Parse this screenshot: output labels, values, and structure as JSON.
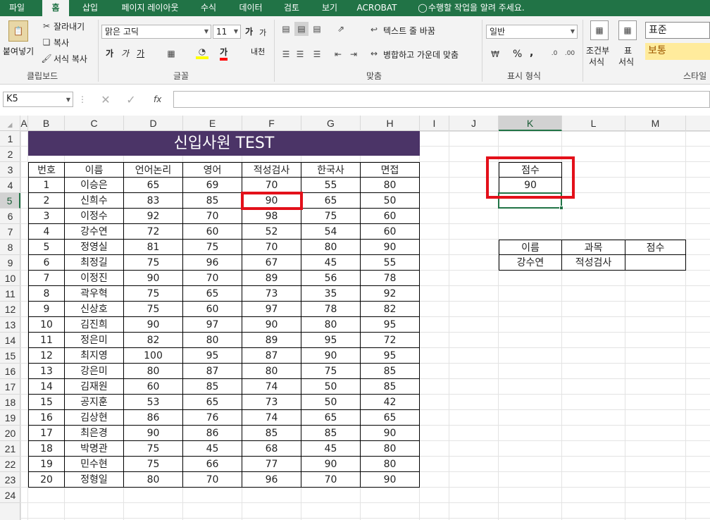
{
  "tabs": [
    {
      "label": "파일",
      "active": false
    },
    {
      "label": "홈",
      "active": true
    },
    {
      "label": "삽입",
      "active": false
    },
    {
      "label": "페이지 레이아웃",
      "active": false
    },
    {
      "label": "수식",
      "active": false
    },
    {
      "label": "데이터",
      "active": false
    },
    {
      "label": "검토",
      "active": false
    },
    {
      "label": "보기",
      "active": false
    },
    {
      "label": "ACROBAT",
      "active": false
    }
  ],
  "tell_me": "수행할 작업을 알려 주세요.",
  "ribbon": {
    "clipboard": {
      "group": "클립보드",
      "paste": "붙여넣기",
      "cut": "잘라내기",
      "copy": "복사",
      "format_painter": "서식 복사"
    },
    "font": {
      "group": "글꼴",
      "name": "맑은 고딕",
      "size": "11",
      "grow": "가",
      "shrink": "가",
      "bold": "가",
      "italic": "가",
      "underline": "가",
      "font_color": "가",
      "phonetic": "내천"
    },
    "alignment": {
      "group": "맞춤",
      "wrap_text": "텍스트 줄 바꿈",
      "merge_center": "병합하고 가운데 맞춤"
    },
    "number": {
      "group": "표시 형식",
      "format": "일반",
      "percent": "%",
      "comma": ","
    },
    "styles": {
      "group": "스타일",
      "conditional": "조건부",
      "conditional2": "서식",
      "table": "표",
      "table2": "서식",
      "normal": "표준",
      "neutral": "보통"
    }
  },
  "formula_bar": {
    "name_box": "K5",
    "fx": "fx",
    "value": ""
  },
  "columns": [
    "A",
    "B",
    "C",
    "D",
    "E",
    "F",
    "G",
    "H",
    "I",
    "J",
    "K",
    "L",
    "M"
  ],
  "rows": [
    "1",
    "2",
    "3",
    "4",
    "5",
    "6",
    "7",
    "8",
    "9",
    "10",
    "11",
    "12",
    "13",
    "14",
    "15",
    "16",
    "17",
    "18",
    "19",
    "20",
    "21",
    "22",
    "23",
    "24"
  ],
  "selected_col": "K",
  "selected_row": "5",
  "sheet": {
    "title": "신입사원 TEST",
    "headers": [
      "번호",
      "이름",
      "언어논리",
      "영어",
      "적성검사",
      "한국사",
      "면접"
    ],
    "data": [
      [
        "1",
        "이승은",
        "65",
        "69",
        "70",
        "55",
        "80"
      ],
      [
        "2",
        "신희수",
        "83",
        "85",
        "90",
        "65",
        "50"
      ],
      [
        "3",
        "이정수",
        "92",
        "70",
        "98",
        "75",
        "60"
      ],
      [
        "4",
        "강수연",
        "72",
        "60",
        "52",
        "54",
        "60"
      ],
      [
        "5",
        "정영실",
        "81",
        "75",
        "70",
        "80",
        "90"
      ],
      [
        "6",
        "최정길",
        "75",
        "96",
        "67",
        "45",
        "55"
      ],
      [
        "7",
        "이정진",
        "90",
        "70",
        "89",
        "56",
        "78"
      ],
      [
        "8",
        "곽우혁",
        "75",
        "65",
        "73",
        "35",
        "92"
      ],
      [
        "9",
        "신상호",
        "75",
        "60",
        "97",
        "78",
        "82"
      ],
      [
        "10",
        "김진희",
        "90",
        "97",
        "90",
        "80",
        "95"
      ],
      [
        "11",
        "정은미",
        "82",
        "80",
        "89",
        "95",
        "72"
      ],
      [
        "12",
        "최지영",
        "100",
        "95",
        "87",
        "90",
        "95"
      ],
      [
        "13",
        "강은미",
        "80",
        "87",
        "80",
        "75",
        "85"
      ],
      [
        "14",
        "김재원",
        "60",
        "85",
        "74",
        "50",
        "85"
      ],
      [
        "15",
        "공지훈",
        "53",
        "65",
        "73",
        "50",
        "42"
      ],
      [
        "16",
        "김상현",
        "86",
        "76",
        "74",
        "65",
        "65"
      ],
      [
        "17",
        "최은경",
        "90",
        "86",
        "85",
        "85",
        "90"
      ],
      [
        "18",
        "박명관",
        "75",
        "45",
        "68",
        "45",
        "80"
      ],
      [
        "19",
        "민수현",
        "75",
        "66",
        "77",
        "90",
        "80"
      ],
      [
        "20",
        "정형일",
        "80",
        "70",
        "96",
        "70",
        "90"
      ]
    ],
    "score_box": {
      "header": "점수",
      "value": "90"
    },
    "lookup": {
      "headers": [
        "이름",
        "과목",
        "점수"
      ],
      "values": [
        "강수연",
        "적성검사",
        ""
      ]
    }
  },
  "colors": {
    "excel_green": "#217346",
    "title_bg": "#4b3467",
    "highlight": "#e3101a",
    "neutral_fill": "#ffeb9c"
  }
}
